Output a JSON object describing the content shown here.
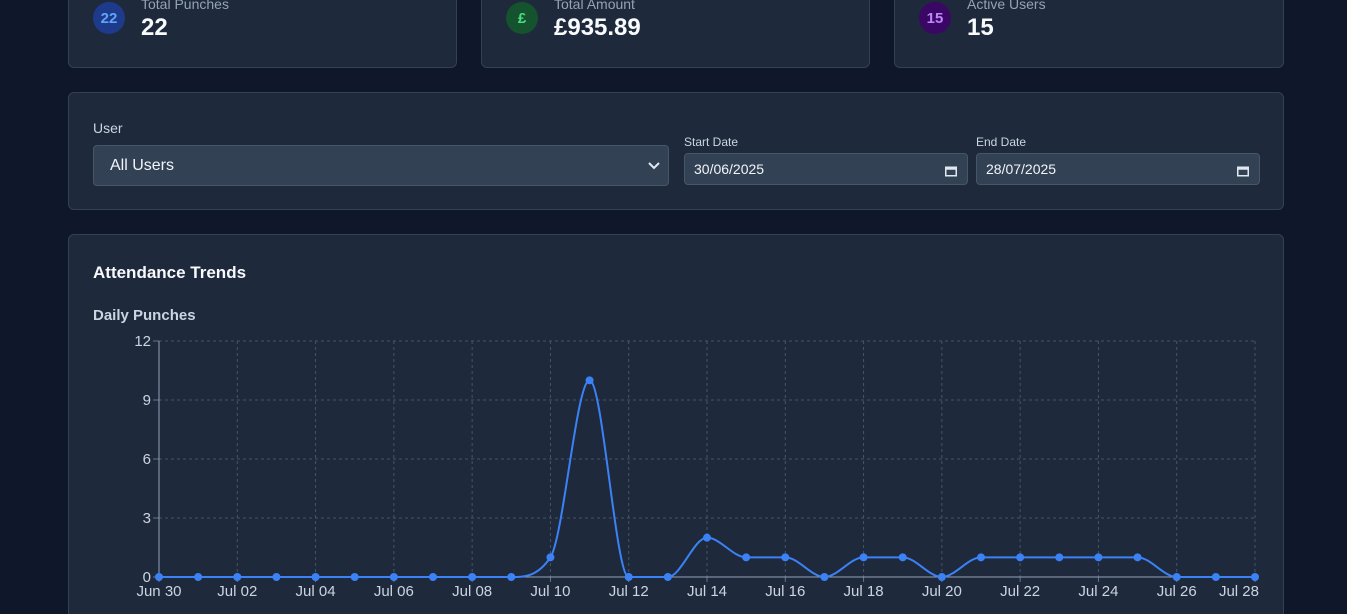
{
  "stats": [
    {
      "badge": "22",
      "label": "Total Punches",
      "value": "22",
      "badge_color": "#3b82f6",
      "badge_bg": "#1e3a8a"
    },
    {
      "badge": "£",
      "label": "Total Amount",
      "value": "£935.89",
      "badge_color": "#4ade80",
      "badge_bg": "#14532d"
    },
    {
      "badge": "15",
      "label": "Active Users",
      "value": "15",
      "badge_color": "#c084fc",
      "badge_bg": "#3b0764"
    }
  ],
  "filters": {
    "user_label": "User",
    "user_value": "All Users",
    "start_label": "Start Date",
    "start_value": "30/06/2025",
    "end_label": "End Date",
    "end_value": "28/07/2025"
  },
  "chart": {
    "section_title": "Attendance Trends",
    "subtitle": "Daily Punches"
  },
  "chart_data": {
    "type": "line",
    "title": "Daily Punches",
    "line_color": "#3b82f6",
    "ylim": [
      0,
      12
    ],
    "yticks": [
      0,
      3,
      6,
      9,
      12
    ],
    "grid": true,
    "xtick_labels": [
      "Jun 30",
      "Jul 02",
      "Jul 04",
      "Jul 06",
      "Jul 08",
      "Jul 10",
      "Jul 12",
      "Jul 14",
      "Jul 16",
      "Jul 18",
      "Jul 20",
      "Jul 22",
      "Jul 24",
      "Jul 26",
      "Jul 28"
    ],
    "x": [
      "Jun 30",
      "Jul 01",
      "Jul 02",
      "Jul 03",
      "Jul 04",
      "Jul 05",
      "Jul 06",
      "Jul 07",
      "Jul 08",
      "Jul 09",
      "Jul 10",
      "Jul 11",
      "Jul 12",
      "Jul 13",
      "Jul 14",
      "Jul 15",
      "Jul 16",
      "Jul 17",
      "Jul 18",
      "Jul 19",
      "Jul 20",
      "Jul 21",
      "Jul 22",
      "Jul 23",
      "Jul 24",
      "Jul 25",
      "Jul 26",
      "Jul 27",
      "Jul 28"
    ],
    "values": [
      0,
      0,
      0,
      0,
      0,
      0,
      0,
      0,
      0,
      0,
      1,
      10,
      0,
      0,
      2,
      1,
      1,
      0,
      1,
      1,
      0,
      1,
      1,
      1,
      1,
      1,
      0,
      0,
      0
    ]
  }
}
